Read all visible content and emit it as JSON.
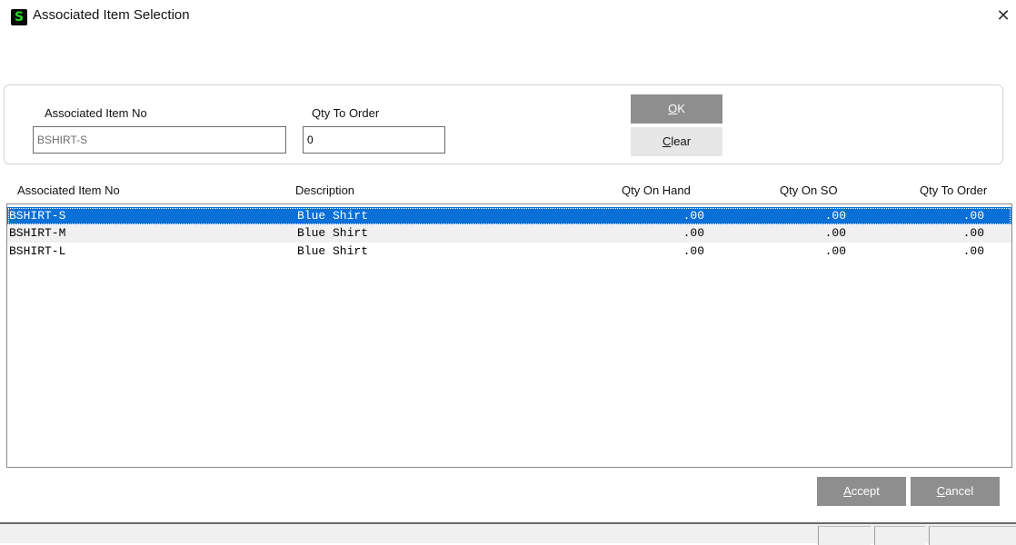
{
  "window": {
    "title": "Associated Item Selection",
    "app_icon_glyph": "S",
    "close_glyph": "✕"
  },
  "entry": {
    "item_no_label": "Associated Item No",
    "item_no_value": "BSHIRT-S",
    "qty_label": "Qty To Order",
    "qty_value": "0",
    "ok_label_accel": "O",
    "ok_label_rest": "K",
    "clear_label_accel": "C",
    "clear_label_rest": "lear"
  },
  "grid": {
    "columns": [
      "Associated Item No",
      "Description",
      "Qty On Hand",
      "Qty On SO",
      "Qty To Order"
    ],
    "rows": [
      {
        "item_no": "BSHIRT-S",
        "description": "Blue Shirt",
        "qty_on_hand": ".00",
        "qty_on_so": ".00",
        "qty_to_order": ".00",
        "selected": true
      },
      {
        "item_no": "BSHIRT-M",
        "description": "Blue Shirt",
        "qty_on_hand": ".00",
        "qty_on_so": ".00",
        "qty_to_order": ".00",
        "selected": false
      },
      {
        "item_no": "BSHIRT-L",
        "description": "Blue Shirt",
        "qty_on_hand": ".00",
        "qty_on_so": ".00",
        "qty_to_order": ".00",
        "selected": false
      }
    ]
  },
  "footer": {
    "accept_accel": "A",
    "accept_rest": "ccept",
    "cancel_accel": "C",
    "cancel_rest": "ancel"
  },
  "colors": {
    "selection": "#0a6fd6",
    "button_gray": "#8e8e8e",
    "app_icon_green": "#2bd52b"
  }
}
